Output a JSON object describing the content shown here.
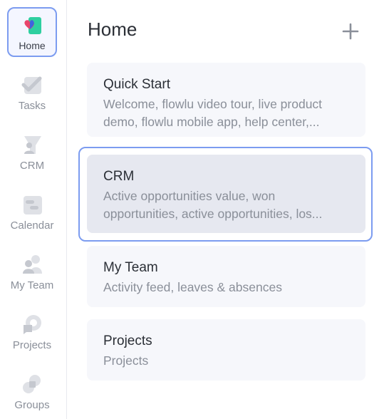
{
  "sidebar": {
    "items": [
      {
        "label": "Home",
        "icon": "home-heart-icon",
        "active": true
      },
      {
        "label": "Tasks",
        "icon": "tasks-check-icon",
        "active": false
      },
      {
        "label": "CRM",
        "icon": "crm-funnel-icon",
        "active": false
      },
      {
        "label": "Calendar",
        "icon": "calendar-icon",
        "active": false
      },
      {
        "label": "My Team",
        "icon": "team-people-icon",
        "active": false
      },
      {
        "label": "Projects",
        "icon": "projects-chat-icon",
        "active": false
      },
      {
        "label": "Groups",
        "icon": "groups-shapes-icon",
        "active": false
      }
    ]
  },
  "header": {
    "title": "Home",
    "add_icon": "plus-icon"
  },
  "cards": [
    {
      "title": "Quick Start",
      "description": "Welcome, flowlu video tour, live product demo, flowlu mobile app, help center,..."
    },
    {
      "title": "CRM",
      "description": "Active opportunities value, won opportunities, active opportunities, los..."
    },
    {
      "title": "My Team",
      "description": "Activity feed, leaves & absences"
    },
    {
      "title": "Projects",
      "description": "Projects"
    }
  ],
  "colors": {
    "accent_border": "#7c9cf0",
    "icon_gray": "#c5c8cf",
    "home_icon_green": "#2ecfa0",
    "home_icon_heart": "#e8456b",
    "home_icon_blue": "#3c63e0",
    "card_bg": "#f6f7fb",
    "card_highlight_bg": "#e6e8f0"
  }
}
